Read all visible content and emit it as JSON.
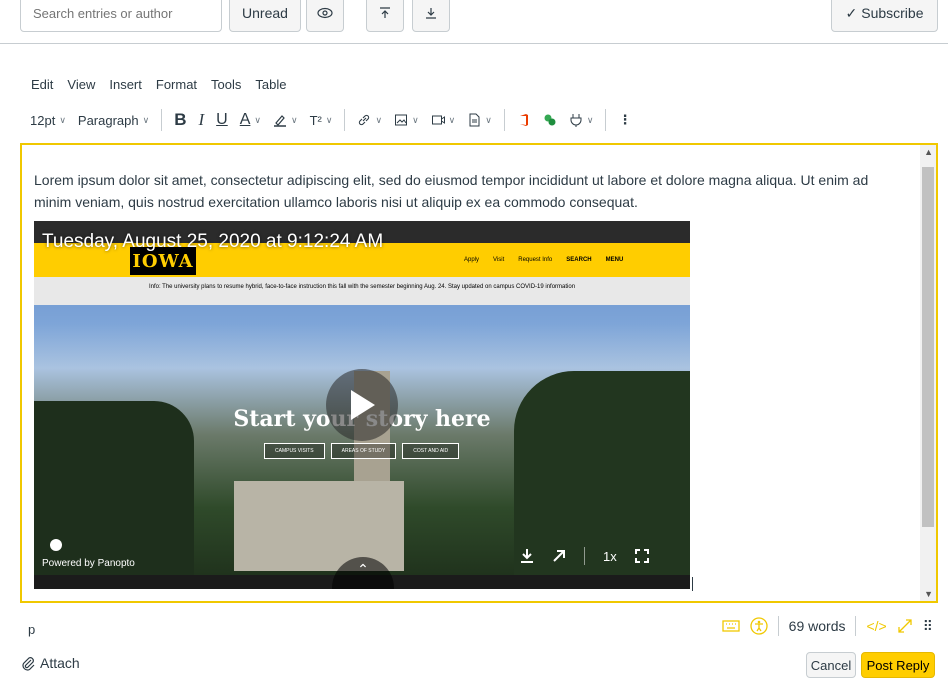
{
  "topbar": {
    "search_placeholder": "Search entries or author",
    "unread_label": "Unread",
    "subscribe_label": "Subscribe"
  },
  "menubar": {
    "items": [
      "Edit",
      "View",
      "Insert",
      "Format",
      "Tools",
      "Table"
    ]
  },
  "toolbar": {
    "font_size": "12pt",
    "block_format": "Paragraph",
    "bold": "B",
    "italic": "I",
    "underline": "U",
    "text_color": "A",
    "superscript": "T²"
  },
  "editor": {
    "body_text": "Lorem ipsum dolor sit amet, consectetur adipiscing elit, sed do eiusmod tempor incididunt ut labore et dolore magna aliqua. Ut enim ad minim veniam, quis nostrud exercitation ullamco laboris nisi ut aliquip ex ea commodo consequat."
  },
  "video": {
    "timestamp": "Tuesday, August 25, 2020 at 9:12:24 AM",
    "logo_text": "IOWA",
    "nav": [
      "Apply",
      "Visit",
      "Request Info",
      "SEARCH",
      "MENU"
    ],
    "info_text": "Info: The university plans to resume hybrid, face-to-face instruction this fall with the semester beginning Aug. 24. Stay updated on campus COVID-19 information",
    "hero_title": "Start your story here",
    "hero_buttons": [
      "CAMPUS VISITS",
      "AREAS OF STUDY",
      "COST AND AID"
    ],
    "powered_by": "Powered by Panopto",
    "speed": "1x"
  },
  "status": {
    "path": "p",
    "word_count": "69 words"
  },
  "footer": {
    "attach_label": "Attach",
    "cancel_label": "Cancel",
    "post_label": "Post Reply"
  },
  "colors": {
    "accent": "#ffcd00",
    "editor_border": "#f0c800",
    "text": "#2d3b45"
  }
}
